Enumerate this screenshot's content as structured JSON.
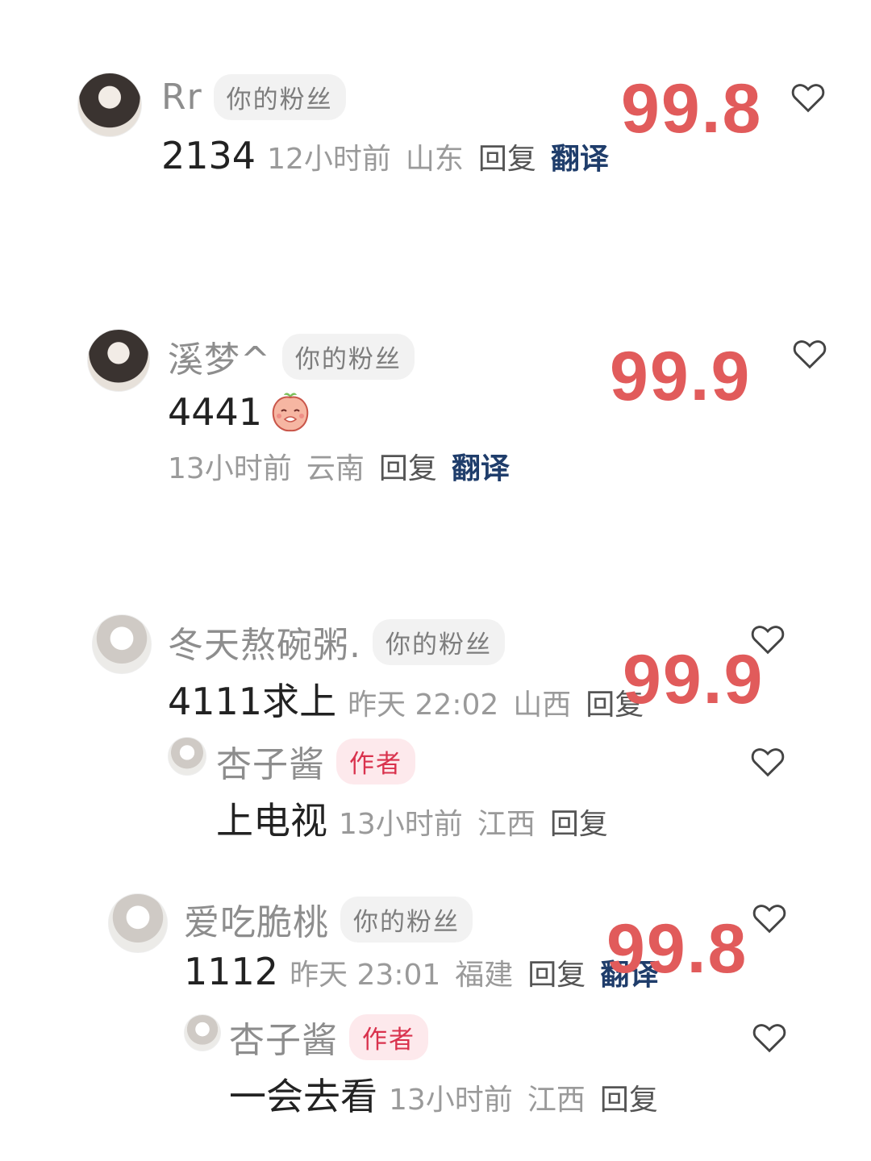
{
  "comments": [
    {
      "username": "Rr",
      "badge": "你的粉丝",
      "content": "2134",
      "time": "12小时前",
      "location": "山东",
      "reply": "回复",
      "translate": "翻译",
      "score": "99.8"
    },
    {
      "username": "溪梦^",
      "badge": "你的粉丝",
      "content": "4441",
      "time": "13小时前",
      "location": "云南",
      "reply": "回复",
      "translate": "翻译",
      "score": "99.9"
    },
    {
      "username": "冬天熬碗粥.",
      "badge": "你的粉丝",
      "content": "4111求上",
      "time": "昨天 22:02",
      "location": "山西",
      "reply": "回复",
      "score": "99.9",
      "sub_reply": {
        "username": "杏子酱",
        "badge": "作者",
        "content": "上电视",
        "time": "13小时前",
        "location": "江西",
        "reply": "回复"
      }
    },
    {
      "username": "爱吃脆桃",
      "badge": "你的粉丝",
      "content": "1112",
      "time": "昨天 23:01",
      "location": "福建",
      "reply": "回复",
      "translate": "翻译",
      "score": "99.8",
      "sub_reply": {
        "username": "杏子酱",
        "badge": "作者",
        "content": "一会去看",
        "time": "13小时前",
        "location": "江西",
        "reply": "回复"
      }
    }
  ],
  "colors": {
    "score": "#e15b5b",
    "translate": "#1f3d6b",
    "author_badge": "#d9324d"
  },
  "icons": {
    "like": "heart-outline-icon",
    "emoji": "peach-emoji-icon"
  }
}
